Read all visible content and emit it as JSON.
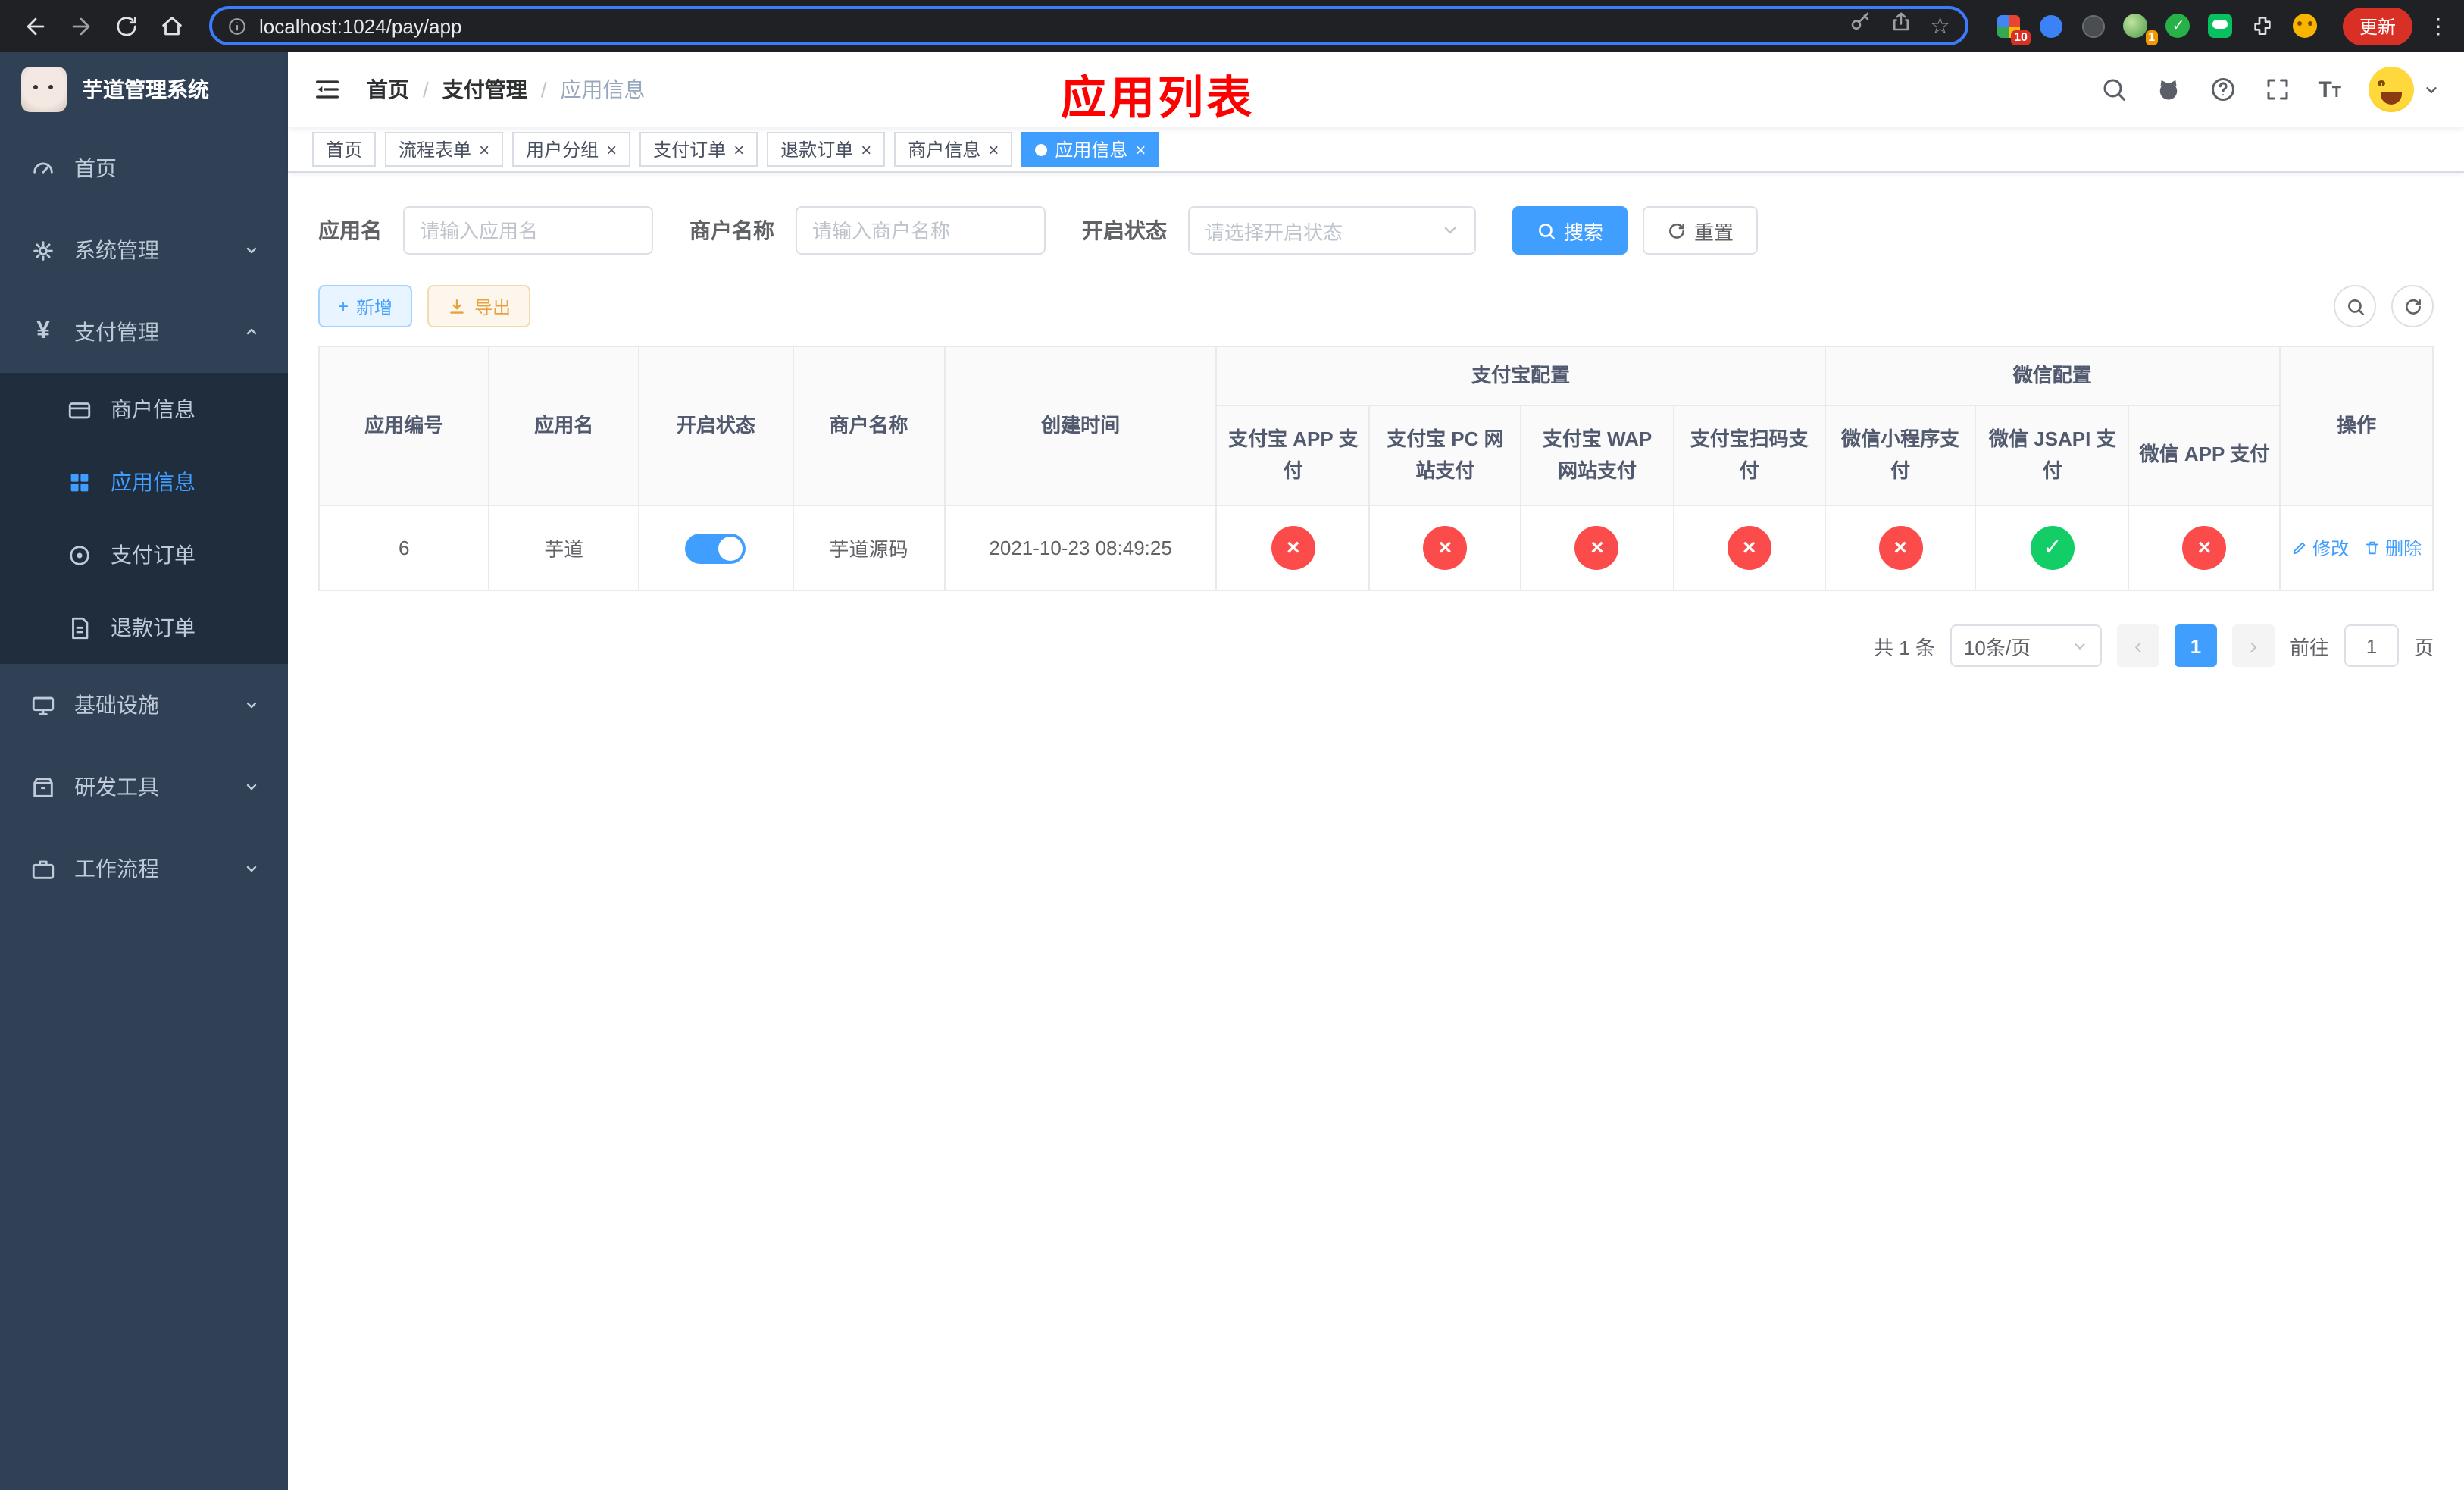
{
  "browser": {
    "url": "localhost:1024/pay/app",
    "update_label": "更新",
    "extensions_badge": "10",
    "profile_badge": "1"
  },
  "sidebar": {
    "title": "芋道管理系统",
    "home": "首页",
    "system": "系统管理",
    "payment": "支付管理",
    "merchant_info": "商户信息",
    "app_info": "应用信息",
    "pay_order": "支付订单",
    "refund_order": "退款订单",
    "infra": "基础设施",
    "devtools": "研发工具",
    "workflow": "工作流程"
  },
  "header": {
    "breadcrumb": [
      "首页",
      "支付管理",
      "应用信息"
    ],
    "annotation": "应用列表"
  },
  "tabs": [
    {
      "label": "首页",
      "closable": false,
      "active": false
    },
    {
      "label": "流程表单",
      "closable": true,
      "active": false
    },
    {
      "label": "用户分组",
      "closable": true,
      "active": false
    },
    {
      "label": "支付订单",
      "closable": true,
      "active": false
    },
    {
      "label": "退款订单",
      "closable": true,
      "active": false
    },
    {
      "label": "商户信息",
      "closable": true,
      "active": false
    },
    {
      "label": "应用信息",
      "closable": true,
      "active": true
    }
  ],
  "filters": {
    "app_name_label": "应用名",
    "app_name_placeholder": "请输入应用名",
    "merchant_label": "商户名称",
    "merchant_placeholder": "请输入商户名称",
    "status_label": "开启状态",
    "status_placeholder": "请选择开启状态",
    "search_label": "搜索",
    "reset_label": "重置"
  },
  "toolbar": {
    "add_label": "新增",
    "export_label": "导出"
  },
  "table": {
    "headers": {
      "app_id": "应用编号",
      "app_name": "应用名",
      "status": "开启状态",
      "merchant": "商户名称",
      "create_time": "创建时间",
      "alipay_group": "支付宝配置",
      "wechat_group": "微信配置",
      "alipay_app": "支付宝 APP 支付",
      "alipay_pc": "支付宝 PC 网站支付",
      "alipay_wap": "支付宝 WAP 网站支付",
      "alipay_qr": "支付宝扫码支付",
      "wx_mini": "微信小程序支付",
      "wx_jsapi": "微信 JSAPI 支付",
      "wx_app": "微信 APP 支付",
      "actions": "操作"
    },
    "rows": [
      {
        "app_id": "6",
        "app_name": "芋道",
        "status_on": true,
        "merchant": "芋道源码",
        "create_time": "2021-10-23 08:49:25",
        "configs": [
          "disabled",
          "disabled",
          "disabled",
          "disabled",
          "disabled",
          "enabled",
          "disabled"
        ],
        "edit_label": "修改",
        "delete_label": "删除"
      }
    ]
  },
  "pagination": {
    "total_label": "共 1 条",
    "page_size": "10条/页",
    "prev_glyph": "‹",
    "next_glyph": "›",
    "current_page": "1",
    "goto_label": "前往",
    "goto_value": "1",
    "page_label": "页"
  },
  "icons": {
    "close": "×",
    "check": "✓",
    "cross": "×",
    "yen": "¥",
    "plus": "+",
    "star": "☆",
    "big_t": "T",
    "small_t": "T",
    "kebab": "⋮"
  },
  "colors": {
    "primary": "#409eff",
    "danger": "#fb4b4b",
    "success": "#13ce66",
    "warning": "#e6a23c",
    "annotation": "#fe0000",
    "sidebar_bg": "#304156",
    "submenu_bg": "#1f2d3d"
  }
}
